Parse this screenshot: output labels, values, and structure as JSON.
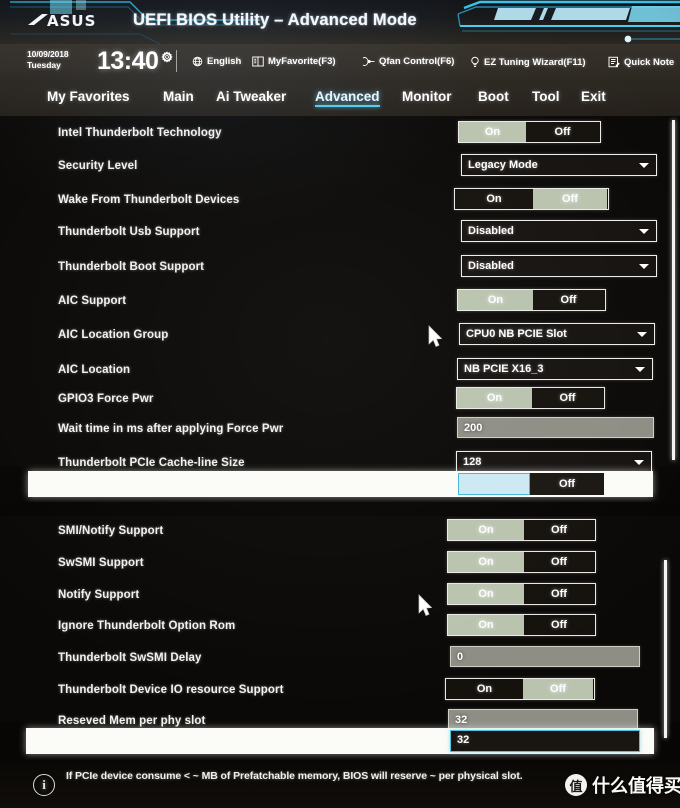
{
  "window": {
    "brand": "ASUS",
    "title": "UEFI BIOS Utility – Advanced Mode"
  },
  "toolbar": {
    "date": "10/09/2018",
    "weekday": "Tuesday",
    "time": "13:40",
    "gear_icon": "gear-icon",
    "items": [
      {
        "label": "English",
        "icon": "globe-icon"
      },
      {
        "label": "MyFavorite(F3)",
        "icon": "book-icon"
      },
      {
        "label": "Qfan Control(F6)",
        "icon": "fan-icon"
      },
      {
        "label": "EZ Tuning Wizard(F11)",
        "icon": "bulb-icon"
      },
      {
        "label": "Quick Note",
        "icon": "note-icon"
      }
    ]
  },
  "nav": {
    "tabs": [
      {
        "label": "My Favorites",
        "active": false
      },
      {
        "label": "Main",
        "active": false
      },
      {
        "label": "Ai Tweaker",
        "active": false
      },
      {
        "label": "Advanced",
        "active": true
      },
      {
        "label": "Monitor",
        "active": false
      },
      {
        "label": "Boot",
        "active": false
      },
      {
        "label": "Tool",
        "active": false
      },
      {
        "label": "Exit",
        "active": false
      }
    ]
  },
  "colors": {
    "accent_cyan": "#57c8e8",
    "toggle_on_bg": "#b9c3ae",
    "input_bg": "#8e8e85",
    "highlight_band": "#fbfbf8",
    "selected_border": "#4fc2df",
    "panel_bg": "#0b0907"
  },
  "upper_panel": {
    "rows": [
      {
        "label": "Intel Thunderbolt Technology",
        "type": "toggle",
        "on_label": "On",
        "off_label": "Off",
        "value": "On"
      },
      {
        "label": "Security Level",
        "type": "dropdown",
        "value": "Legacy Mode"
      },
      {
        "label": "Wake From Thunderbolt Devices",
        "type": "toggle",
        "on_label": "On",
        "off_label": "Off",
        "value": "Off"
      },
      {
        "label": "Thunderbolt Usb Support",
        "type": "dropdown",
        "value": "Disabled"
      },
      {
        "label": "Thunderbolt Boot Support",
        "type": "dropdown",
        "value": "Disabled"
      },
      {
        "label": "AIC Support",
        "type": "toggle",
        "on_label": "On",
        "off_label": "Off",
        "value": "On"
      },
      {
        "label": "AIC Location Group",
        "type": "dropdown",
        "value": "CPU0 NB PCIE Slot"
      },
      {
        "label": "AIC Location",
        "type": "dropdown",
        "value": "NB PCIE X16_3"
      },
      {
        "label": "GPIO3 Force Pwr",
        "type": "toggle",
        "on_label": "On",
        "off_label": "Off",
        "value": "On"
      },
      {
        "label": "Wait time in ms after applying Force Pwr",
        "type": "input",
        "value": "200"
      },
      {
        "label": "Thunderbolt PCIe Cache-line Size",
        "type": "dropdown",
        "value": "128"
      }
    ],
    "selected_row": {
      "label": "",
      "type": "toggle",
      "on_label": "",
      "off_label": "Off",
      "value": "On"
    }
  },
  "lower_panel": {
    "rows": [
      {
        "label": "SMI/Notify Support",
        "type": "toggle",
        "on_label": "On",
        "off_label": "Off",
        "value": "On"
      },
      {
        "label": "SwSMI Support",
        "type": "toggle",
        "on_label": "On",
        "off_label": "Off",
        "value": "On"
      },
      {
        "label": "Notify Support",
        "type": "toggle",
        "on_label": "On",
        "off_label": "Off",
        "value": "On"
      },
      {
        "label": "Ignore Thunderbolt Option Rom",
        "type": "toggle",
        "on_label": "On",
        "off_label": "Off",
        "value": "On"
      },
      {
        "label": "Thunderbolt SwSMI Delay",
        "type": "input",
        "value": "0"
      },
      {
        "label": "Thunderbolt Device IO resource Support",
        "type": "toggle",
        "on_label": "On",
        "off_label": "Off",
        "value": "Off"
      },
      {
        "label": "Reseved Mem per phy slot",
        "type": "input",
        "value": "32"
      }
    ],
    "selected_row": {
      "label": "",
      "type": "input",
      "value": "32"
    }
  },
  "footer": {
    "info_icon": "info-icon",
    "note": "If PCIe device consume < ~ MB of Prefatchable memory, BIOS will reserve ~ per physical slot."
  },
  "watermark": {
    "logo_char": "值",
    "text": "什么值得买"
  }
}
